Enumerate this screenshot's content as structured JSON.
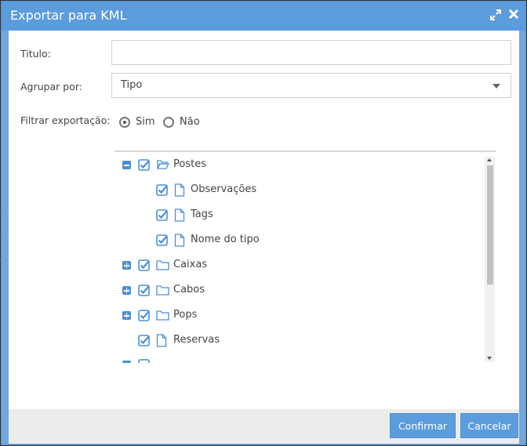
{
  "dialog": {
    "title": "Exportar para KML"
  },
  "form": {
    "titulo_label": "Titulo:",
    "titulo_value": "",
    "agrupar_label": "Agrupar por:",
    "agrupar_value": "Tipo",
    "filtrar_label": "Filtrar exportação:",
    "radio_sim": "Sim",
    "radio_nao": "Não",
    "selected": "Sim"
  },
  "tree": {
    "nodes": [
      {
        "label": "Postes",
        "expanded": true,
        "checked": true,
        "type": "folder-open"
      },
      {
        "label": "Observações",
        "checked": true,
        "type": "file"
      },
      {
        "label": "Tags",
        "checked": true,
        "type": "file"
      },
      {
        "label": "Nome do tipo",
        "checked": true,
        "type": "file"
      },
      {
        "label": "Caixas",
        "expanded": false,
        "checked": true,
        "type": "folder"
      },
      {
        "label": "Cabos",
        "expanded": false,
        "checked": true,
        "type": "folder"
      },
      {
        "label": "Pops",
        "expanded": false,
        "checked": true,
        "type": "folder"
      },
      {
        "label": "Reservas",
        "checked": true,
        "type": "file"
      }
    ]
  },
  "footer": {
    "confirm_label": "Confirmar",
    "cancel_label": "Cancelar"
  },
  "colors": {
    "accent": "#5b9cdd",
    "check": "#4a8fd2"
  },
  "icons": {
    "expand": "expand-icon",
    "close": "close-icon",
    "dropdown": "chevron-down-icon"
  }
}
